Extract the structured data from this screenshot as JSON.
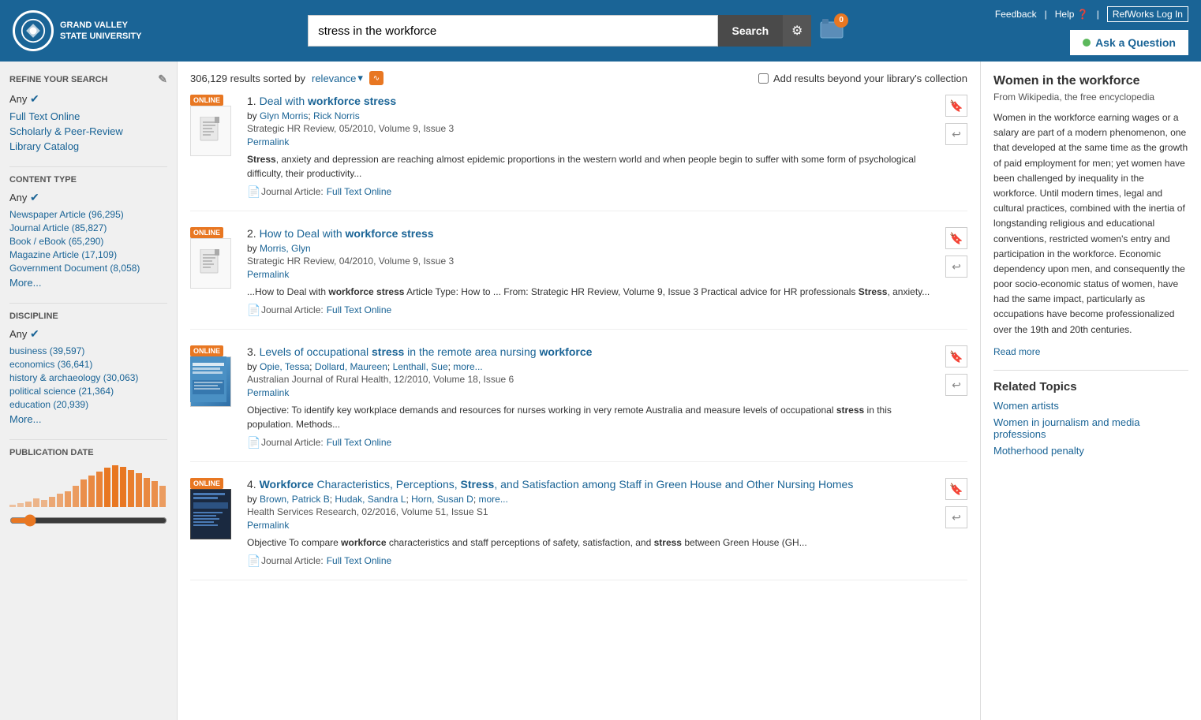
{
  "header": {
    "logo_name": "Grand Valley State University",
    "search_value": "stress in the workforce",
    "search_placeholder": "stress in the workforce",
    "search_btn_label": "Search",
    "cart_count": "0",
    "ask_question_label": "Ask a Question",
    "feedback_label": "Feedback",
    "help_label": "Help",
    "refworks_label": "RefWorks Log In"
  },
  "results_bar": {
    "count": "306,129",
    "sorted_by": "sorted by",
    "relevance_label": "relevance",
    "add_beyond_label": "Add results beyond your library's collection"
  },
  "sidebar": {
    "refine_title": "REFINE YOUR SEARCH",
    "any_label": "Any",
    "full_text_online": "Full Text Online",
    "scholarly_peer_review": "Scholarly & Peer-Review",
    "library_catalog": "Library Catalog",
    "content_type_title": "CONTENT TYPE",
    "content_any": "Any",
    "newspaper_article": "Newspaper Article (96,295)",
    "journal_article": "Journal Article (85,827)",
    "book_ebook": "Book / eBook (65,290)",
    "magazine_article": "Magazine Article (17,109)",
    "government_doc": "Government Document (8,058)",
    "more_content": "More...",
    "discipline_title": "DISCIPLINE",
    "discipline_any": "Any",
    "business": "business (39,597)",
    "economics": "economics (36,641)",
    "history_archaeology": "history & archaeology (30,063)",
    "political_science": "political science (21,364)",
    "education": "education (20,939)",
    "more_discipline": "More...",
    "pub_date_title": "PUBLICATION DATE"
  },
  "results": [
    {
      "number": "1.",
      "title_pre": "Deal with ",
      "title_highlight": "workforce stress",
      "title_full": "Deal with workforce stress",
      "authors": [
        {
          "name": "Glyn Morris",
          "href": "#"
        },
        {
          "name": "Rick Norris",
          "href": "#"
        }
      ],
      "meta": "Strategic HR Review, 05/2010, Volume 9, Issue 3",
      "permalink": "Permalink",
      "snippet": "Stress, anxiety and depression are reaching almost epidemic proportions in the western world and when people begin to suffer with some form of psychological difficulty, their productivity...",
      "snippet_bold_words": [
        "Stress"
      ],
      "type": "Journal Article:",
      "full_text": "Full Text Online",
      "online": true,
      "has_image": false
    },
    {
      "number": "2.",
      "title_pre": "How to Deal with ",
      "title_highlight": "workforce stress",
      "title_full": "How to Deal with workforce stress",
      "authors": [
        {
          "name": "Morris, Glyn",
          "href": "#"
        }
      ],
      "meta": "Strategic HR Review, 04/2010, Volume 9, Issue 3",
      "permalink": "Permalink",
      "snippet": "...How to Deal with workforce stress Article Type: How to ... From: Strategic HR Review, Volume 9, Issue 3 Practical advice for HR professionals Stress, anxiety...",
      "snippet_bold_words": [
        "workforce stress",
        "Stress"
      ],
      "type": "Journal Article:",
      "full_text": "Full Text Online",
      "online": true,
      "has_image": false
    },
    {
      "number": "3.",
      "title_pre": "Levels of occupational ",
      "title_bold1": "stress",
      "title_mid": " in the remote area nursing ",
      "title_bold2": "workforce",
      "title_full": "Levels of occupational stress in the remote area nursing workforce",
      "authors": [
        {
          "name": "Opie, Tessa",
          "href": "#"
        },
        {
          "name": "Dollard, Maureen",
          "href": "#"
        },
        {
          "name": "Lenthall, Sue",
          "href": "#"
        },
        {
          "name": "more...",
          "href": "#"
        }
      ],
      "meta": "Australian Journal of Rural Health, 12/2010, Volume 18, Issue 6",
      "permalink": "Permalink",
      "snippet": "Objective: To identify key workplace demands and resources for nurses working in very remote Australia and measure levels of occupational stress in this population. Methods...",
      "snippet_bold_words": [
        "stress"
      ],
      "type": "Journal Article:",
      "full_text": "Full Text Online",
      "online": true,
      "has_image": true,
      "image_type": "cover3"
    },
    {
      "number": "4.",
      "title_bold1": "Workforce",
      "title_mid": " Characteristics, Perceptions, ",
      "title_bold2": "Stress",
      "title_end": ", and Satisfaction among Staff in Green House and Other Nursing Homes",
      "title_full": "Workforce Characteristics, Perceptions, Stress, and Satisfaction among Staff in Green House and Other Nursing Homes",
      "authors": [
        {
          "name": "Brown, Patrick B",
          "href": "#"
        },
        {
          "name": "Hudak, Sandra L",
          "href": "#"
        },
        {
          "name": "Horn, Susan D",
          "href": "#"
        },
        {
          "name": "more...",
          "href": "#"
        }
      ],
      "meta": "Health Services Research, 02/2016, Volume 51, Issue S1",
      "permalink": "Permalink",
      "snippet": "Objective To compare workforce characteristics and staff perceptions of safety, satisfaction, and stress between Green House (GH...",
      "snippet_bold_words": [
        "workforce",
        "stress"
      ],
      "type": "Journal Article:",
      "full_text": "Full Text Online",
      "online": true,
      "has_image": true,
      "image_type": "cover4"
    }
  ],
  "right_panel": {
    "title": "Women in the workforce",
    "source": "From Wikipedia, the free encyclopedia",
    "text": "Women in the workforce earning wages or a salary are part of a modern phenomenon, one that developed at the same time as the growth of paid employment for men; yet women have been challenged by inequality in the workforce. Until modern times, legal and cultural practices, combined with the inertia of longstanding religious and educational conventions, restricted women's entry and participation in the workforce. Economic dependency upon men, and consequently the poor socio-economic status of women, have had the same impact, particularly as occupations have become professionalized over the 19th and 20th centuries.",
    "read_more": "Read more",
    "related_topics_title": "Related Topics",
    "related_topics": [
      "Women artists",
      "Women in journalism and media professions",
      "Motherhood penalty"
    ]
  }
}
